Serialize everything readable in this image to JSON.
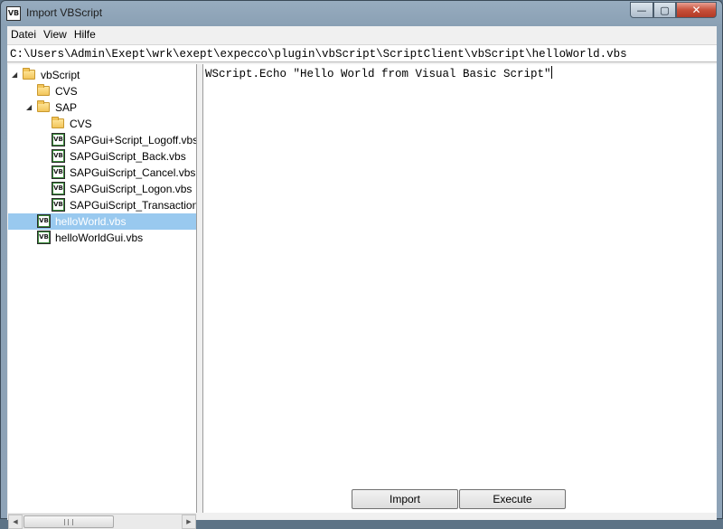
{
  "window": {
    "title": "Import VBScript",
    "icon_text": "VB",
    "min_symbol": "—",
    "max_symbol": "▢",
    "close_symbol": "✕"
  },
  "menu": {
    "items": [
      "Datei",
      "View",
      "Hilfe"
    ]
  },
  "path": "C:\\Users\\Admin\\Exept\\wrk\\exept\\expecco\\plugin\\vbScript\\ScriptClient\\vbScript\\helloWorld.vbs",
  "tree": {
    "expand_arrow": "◢",
    "vb_icon_text": "VB",
    "items": [
      {
        "label": "vbScript",
        "type": "folder",
        "level": 0,
        "expanded": true
      },
      {
        "label": "CVS",
        "type": "folder",
        "level": 1
      },
      {
        "label": "SAP",
        "type": "folder",
        "level": 1,
        "expanded": true
      },
      {
        "label": "CVS",
        "type": "folder",
        "level": 2
      },
      {
        "label": "SAPGui+Script_Logoff.vbs",
        "type": "file",
        "level": 2
      },
      {
        "label": "SAPGuiScript_Back.vbs",
        "type": "file",
        "level": 2
      },
      {
        "label": "SAPGuiScript_Cancel.vbs",
        "type": "file",
        "level": 2
      },
      {
        "label": "SAPGuiScript_Logon.vbs",
        "type": "file",
        "level": 2
      },
      {
        "label": "SAPGuiScript_TransactionCall.vbs",
        "type": "file",
        "level": 2
      },
      {
        "label": "helloWorld.vbs",
        "type": "file",
        "level": 1,
        "selected": true
      },
      {
        "label": "helloWorldGui.vbs",
        "type": "file",
        "level": 1
      }
    ]
  },
  "scrollbar": {
    "left_arrow": "◀",
    "right_arrow": "▶"
  },
  "editor": {
    "code": "WScript.Echo \"Hello World from Visual Basic Script\""
  },
  "buttons": {
    "import_label": "Import",
    "execute_label": "Execute"
  },
  "colors": {
    "selection": "#99c9ef",
    "close_button": "#c7503a"
  }
}
